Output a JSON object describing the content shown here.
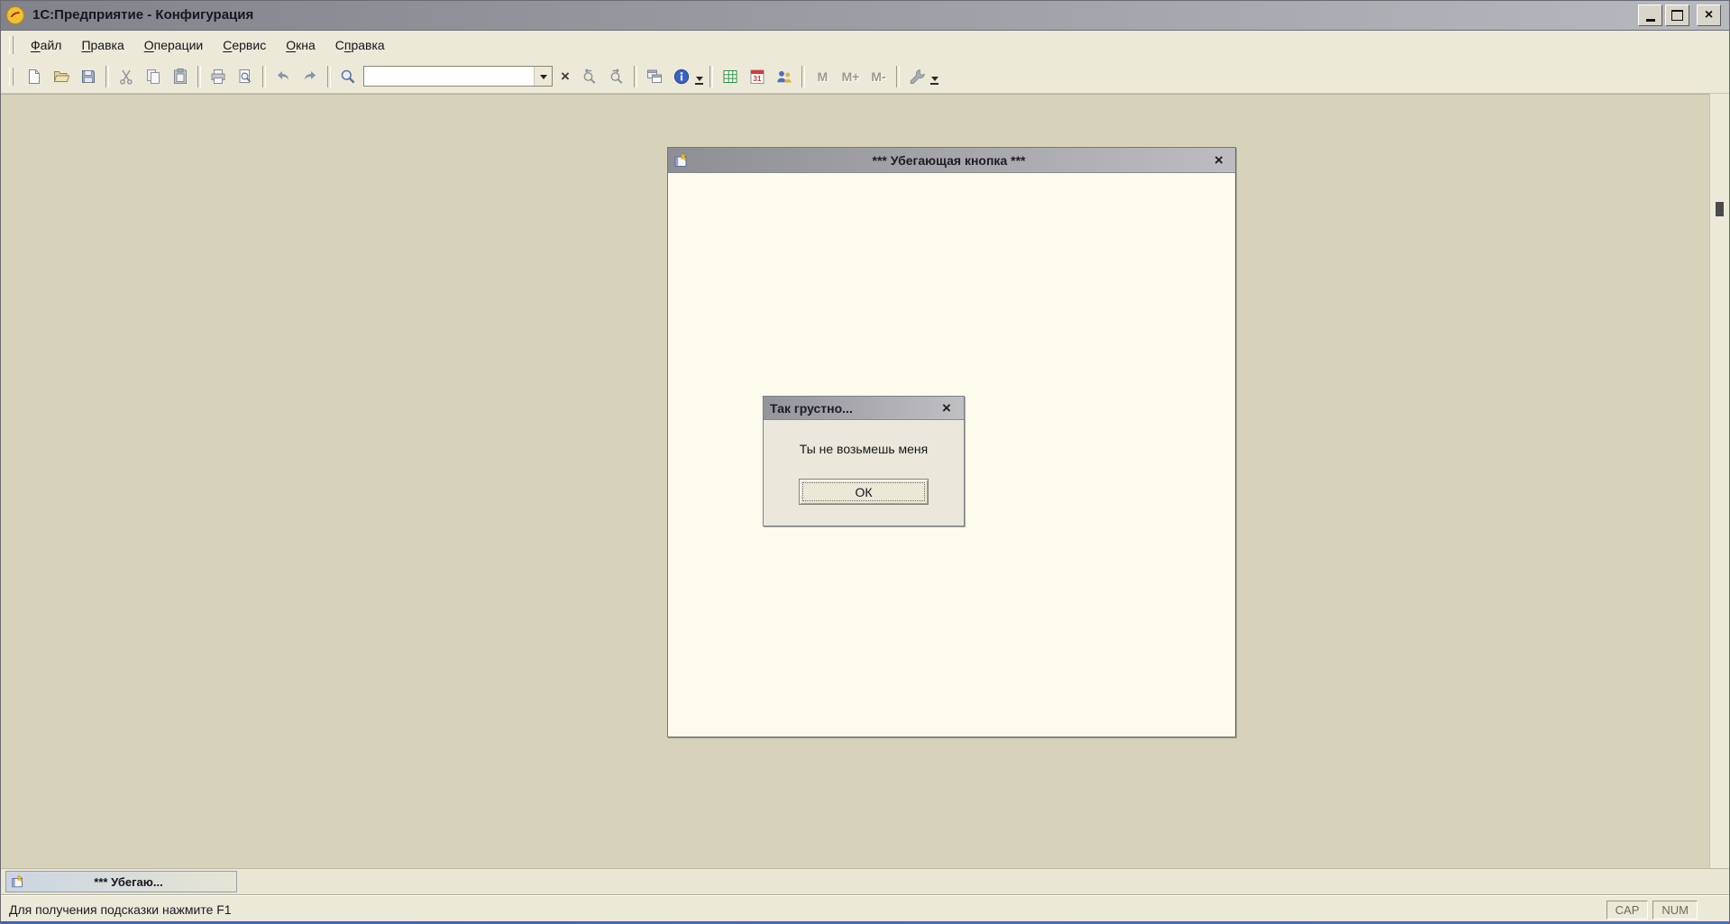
{
  "window": {
    "title": "1С:Предприятие - Конфигурация",
    "close_glyph": "×"
  },
  "menu": {
    "items": [
      {
        "label": "Файл",
        "accel": 0
      },
      {
        "label": "Правка",
        "accel": 0
      },
      {
        "label": "Операции",
        "accel": 0
      },
      {
        "label": "Сервис",
        "accel": 0
      },
      {
        "label": "Окна",
        "accel": 0
      },
      {
        "label": "Справка",
        "accel": 1
      }
    ]
  },
  "toolbar": {
    "search_value": "",
    "clear_glyph": "×",
    "calendar_label": "31",
    "memory": [
      "M",
      "M+",
      "M-"
    ]
  },
  "child_window": {
    "title": "***  Убегающая кнопка ***",
    "close_glyph": "×"
  },
  "dialog": {
    "title": "Так грустно...",
    "message": "Ты не возьмешь меня",
    "ok_label": "ОК",
    "close_glyph": "×"
  },
  "taskbar": {
    "minimized_title": "***  Убегаю..."
  },
  "statusbar": {
    "hint": "Для получения подсказки нажмите F1",
    "indicators": [
      "CAP",
      "NUM"
    ]
  },
  "colors": {
    "titlebar_gradient_start": "#82828a",
    "titlebar_gradient_end": "#b8b8bf",
    "panel_bg": "#ece9d8",
    "workspace_bg": "#d7d3ba",
    "child_content_bg": "#fdfcec",
    "brand_yellow": "#f2c12e",
    "info_blue": "#3a62c4",
    "table_green": "#2f8f3f",
    "calendar_red": "#d2393b"
  }
}
